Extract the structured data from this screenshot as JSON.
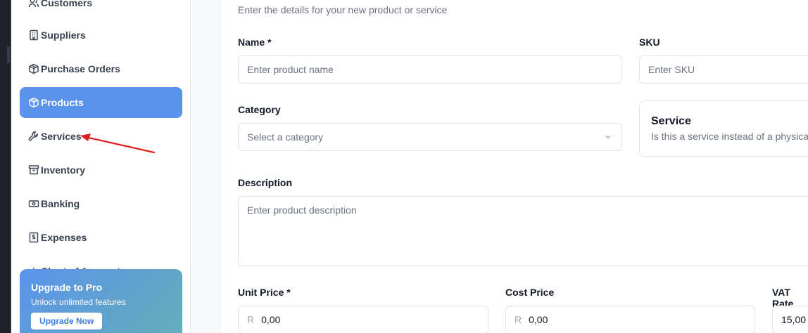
{
  "sidebar": {
    "items": [
      {
        "label": "Customers",
        "icon": "users-icon"
      },
      {
        "label": "Suppliers",
        "icon": "building-icon"
      },
      {
        "label": "Purchase Orders",
        "icon": "package-icon"
      },
      {
        "label": "Products",
        "icon": "package-icon",
        "active": true
      },
      {
        "label": "Services",
        "icon": "wrench-icon"
      },
      {
        "label": "Inventory",
        "icon": "archive-icon"
      },
      {
        "label": "Banking",
        "icon": "banknote-icon"
      },
      {
        "label": "Expenses",
        "icon": "receipt-icon"
      },
      {
        "label": "Chart of Accounts",
        "icon": "chart-icon"
      }
    ],
    "promo": {
      "title": "Upgrade to Pro",
      "subtitle": "Unlock unlimited features",
      "button": "Upgrade Now"
    }
  },
  "form": {
    "subtitle": "Enter the details for your new product or service",
    "name": {
      "label": "Name *",
      "placeholder": "Enter product name"
    },
    "sku": {
      "label": "SKU",
      "placeholder": "Enter SKU"
    },
    "category": {
      "label": "Category",
      "placeholder": "Select a category"
    },
    "service": {
      "title": "Service",
      "description": "Is this a service instead of a physical product?"
    },
    "description": {
      "label": "Description",
      "placeholder": "Enter product description"
    },
    "unit_price": {
      "label": "Unit Price *",
      "prefix": "R",
      "value": "0,00"
    },
    "cost_price": {
      "label": "Cost Price",
      "prefix": "R",
      "value": "0,00"
    },
    "vat_rate": {
      "label": "VAT Rate",
      "value": "15,00"
    }
  },
  "colors": {
    "accent": "#5b93ec",
    "annotation_arrow": "#e11d1d"
  }
}
